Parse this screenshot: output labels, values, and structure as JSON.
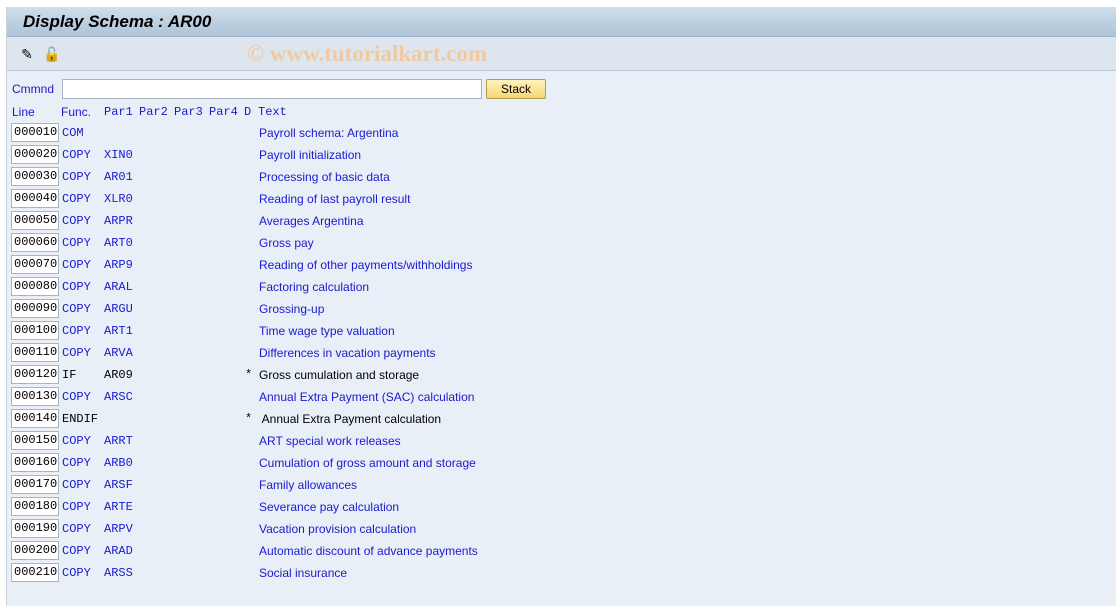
{
  "title": "Display Schema : AR00",
  "toolbar": {
    "icons": [
      "edit-pencil-icon",
      "lock-toggle-icon"
    ],
    "watermark": "© www.tutorialkart.com"
  },
  "command": {
    "label": "Cmmnd",
    "value": "",
    "stack_label": "Stack"
  },
  "columns": {
    "line": "Line",
    "func": "Func.",
    "par1": "Par1",
    "par2": "Par2",
    "par3": "Par3",
    "par4": "Par4",
    "d": "D",
    "text": "Text"
  },
  "rows": [
    {
      "line": "000010",
      "func": "COM",
      "par1": "",
      "d": "",
      "text": "Payroll schema: Argentina",
      "comment": false
    },
    {
      "line": "000020",
      "func": "COPY",
      "par1": "XIN0",
      "d": "",
      "text": "Payroll initialization",
      "comment": false
    },
    {
      "line": "000030",
      "func": "COPY",
      "par1": "AR01",
      "d": "",
      "text": "Processing of basic data",
      "comment": false
    },
    {
      "line": "000040",
      "func": "COPY",
      "par1": "XLR0",
      "d": "",
      "text": "Reading of last payroll result",
      "comment": false
    },
    {
      "line": "000050",
      "func": "COPY",
      "par1": "ARPR",
      "d": "",
      "text": "Averages Argentina",
      "comment": false
    },
    {
      "line": "000060",
      "func": "COPY",
      "par1": "ART0",
      "d": "",
      "text": "Gross pay",
      "comment": false
    },
    {
      "line": "000070",
      "func": "COPY",
      "par1": "ARP9",
      "d": "",
      "text": "Reading of other payments/withholdings",
      "comment": false
    },
    {
      "line": "000080",
      "func": "COPY",
      "par1": "ARAL",
      "d": "",
      "text": "Factoring calculation",
      "comment": false
    },
    {
      "line": "000090",
      "func": "COPY",
      "par1": "ARGU",
      "d": "",
      "text": "Grossing-up",
      "comment": false
    },
    {
      "line": "000100",
      "func": "COPY",
      "par1": "ART1",
      "d": "",
      "text": "Time wage type valuation",
      "comment": false
    },
    {
      "line": "000110",
      "func": "COPY",
      "par1": "ARVA",
      "d": "",
      "text": "Differences in vacation payments",
      "comment": false
    },
    {
      "line": "000120",
      "func": "IF",
      "par1": "AR09",
      "d": "*",
      "text": "Gross cumulation and storage",
      "comment": true
    },
    {
      "line": "000130",
      "func": "COPY",
      "par1": "ARSC",
      "d": "",
      "text": "Annual Extra Payment (SAC) calculation",
      "comment": false
    },
    {
      "line": "000140",
      "func": "ENDIF",
      "par1": "",
      "d": "*",
      "text": " Annual Extra Payment calculation",
      "comment": true
    },
    {
      "line": "000150",
      "func": "COPY",
      "par1": "ARRT",
      "d": "",
      "text": "ART special work releases",
      "comment": false
    },
    {
      "line": "000160",
      "func": "COPY",
      "par1": "ARB0",
      "d": "",
      "text": "Cumulation of gross amount and storage",
      "comment": false
    },
    {
      "line": "000170",
      "func": "COPY",
      "par1": "ARSF",
      "d": "",
      "text": "Family allowances",
      "comment": false
    },
    {
      "line": "000180",
      "func": "COPY",
      "par1": "ARTE",
      "d": "",
      "text": "Severance pay calculation",
      "comment": false
    },
    {
      "line": "000190",
      "func": "COPY",
      "par1": "ARPV",
      "d": "",
      "text": "Vacation provision calculation",
      "comment": false
    },
    {
      "line": "000200",
      "func": "COPY",
      "par1": "ARAD",
      "d": "",
      "text": "Automatic discount of advance payments",
      "comment": false
    },
    {
      "line": "000210",
      "func": "COPY",
      "par1": "ARSS",
      "d": "",
      "text": "Social insurance",
      "comment": false
    }
  ]
}
